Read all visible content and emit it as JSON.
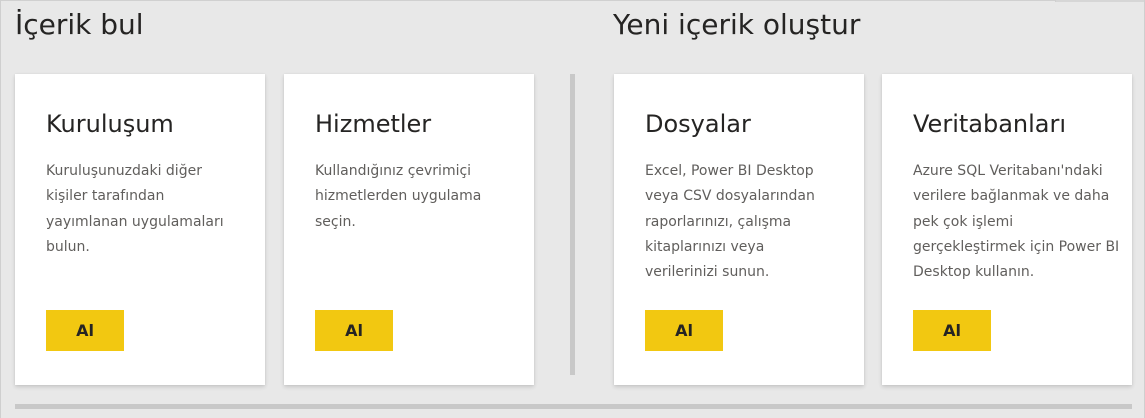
{
  "sections": {
    "find": {
      "title": "İçerik bul"
    },
    "create": {
      "title": "Yeni içerik oluştur"
    }
  },
  "cards": [
    {
      "title": "Kuruluşum",
      "description": "Kuruluşunuzdaki diğer kişiler tarafından yayımlanan uygulamaları bulun.",
      "button_label": "Al"
    },
    {
      "title": "Hizmetler",
      "description": "Kullandığınız çevrimiçi hizmetlerden uygulama seçin.",
      "button_label": "Al"
    },
    {
      "title": "Dosyalar",
      "description": "Excel, Power BI Desktop veya CSV dosyalarından raporlarınızı, çalışma kitaplarınızı veya verilerinizi sunun.",
      "button_label": "Al"
    },
    {
      "title": "Veritabanları",
      "description": "Azure SQL Veritabanı'ndaki verilere bağlanmak ve daha pek çok işlemi gerçekleştirmek için Power BI Desktop kullanın.",
      "button_label": "Al"
    }
  ],
  "colors": {
    "accent_button": "#f2c811",
    "background": "#e8e8e8",
    "card": "#ffffff"
  }
}
